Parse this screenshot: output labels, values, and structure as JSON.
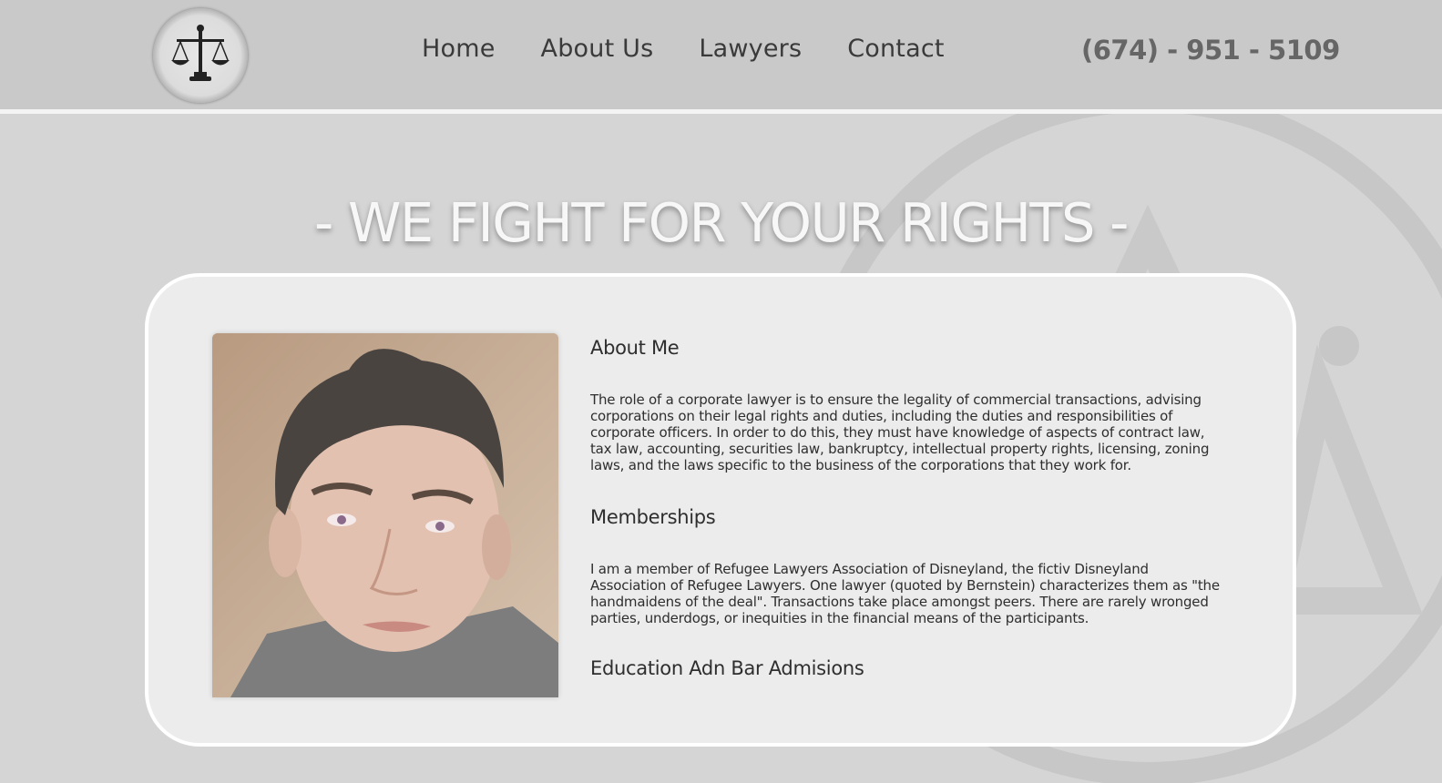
{
  "header": {
    "logo_icon": "scales-of-justice-icon",
    "nav": [
      {
        "label": "Home"
      },
      {
        "label": "About Us"
      },
      {
        "label": "Lawyers"
      },
      {
        "label": "Contact"
      }
    ],
    "phone": "(674) - 951 - 5109"
  },
  "hero": {
    "title": "- WE FIGHT FOR YOUR RIGHTS -"
  },
  "profile": {
    "photo_icon": "lawyer-portrait-photo",
    "sections": {
      "about_heading": "About Me",
      "about_text": "The role of a corporate lawyer is to ensure the legality of commercial transactions, advising corporations on their legal rights and duties, including the duties and responsibilities of corporate officers. In order to do this, they must have knowledge of aspects of contract law, tax law, accounting, securities law, bankruptcy, intellectual property rights, licensing, zoning laws, and the laws specific to the business of the corporations that they work for.",
      "memberships_heading": "Memberships",
      "memberships_text": "I am a member of Refugee Lawyers Association of Disneyland, the fictiv Disneyland Association of Refugee Lawyers. One lawyer (quoted by Bernstein) characterizes them as \"the handmaidens of the deal\". Transactions take place amongst peers. There are rarely wronged parties, underdogs, or inequities in the financial means of the participants.",
      "education_heading": "Education Adn Bar Admisions"
    }
  },
  "colors": {
    "background": "#d5d5d5",
    "header": "#c9c9c9",
    "card": "#ececec",
    "hero_text": "#f7f7f7",
    "phone": "#666666"
  }
}
